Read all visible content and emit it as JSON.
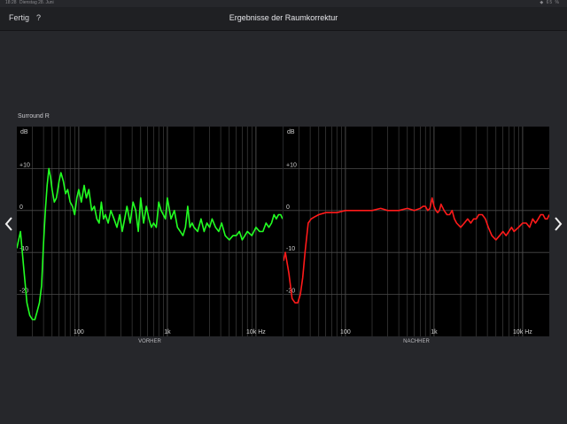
{
  "status_bar": {
    "time": "18:28",
    "date": "Dienstag 28. Juni",
    "right": "◆ 65 %"
  },
  "nav": {
    "done_label": "Fertig",
    "help_label": "?",
    "title": "Ergebnisse der Raumkorrektur"
  },
  "channel_label": "Surround R",
  "colors": {
    "before": "#22ff22",
    "after": "#ff1a1a",
    "grid": "#4a4a4a",
    "background": "#000000"
  },
  "icons": {
    "left": "chevron-left-icon",
    "right": "chevron-right-icon"
  },
  "chart_data": [
    {
      "type": "line",
      "caption": "VORHER",
      "ylabel": "dB",
      "x_scale": "log",
      "xlim": [
        20,
        20000
      ],
      "ylim": [
        -30,
        20
      ],
      "y_ticks": [
        "+10",
        "0",
        "-10",
        "-20"
      ],
      "x_ticks": [
        "100",
        "1k",
        "10k Hz"
      ],
      "grid": true,
      "series": [
        {
          "x": [
            20,
            22,
            24,
            26,
            28,
            30,
            32,
            34,
            36,
            38,
            40,
            42,
            44,
            46,
            48,
            50,
            53,
            56,
            60,
            63,
            67,
            71,
            75,
            80,
            85,
            90,
            95,
            100,
            107,
            115,
            122,
            130,
            140,
            150,
            160,
            170,
            180,
            190,
            200,
            215,
            230,
            250,
            270,
            290,
            310,
            330,
            350,
            380,
            410,
            440,
            470,
            500,
            540,
            580,
            620,
            660,
            700,
            750,
            800,
            850,
            900,
            950,
            1000,
            1100,
            1200,
            1300,
            1400,
            1500,
            1600,
            1700,
            1800,
            1900,
            2000,
            2200,
            2400,
            2600,
            2800,
            3000,
            3200,
            3500,
            3800,
            4100,
            4500,
            5000,
            5500,
            6000,
            6500,
            7000,
            7500,
            8000,
            9000,
            10000,
            11000,
            12000,
            13000,
            14000,
            15000,
            16000,
            17000,
            18000,
            19000,
            20000
          ],
          "y": [
            -9,
            -5,
            -14,
            -22,
            -25,
            -26,
            -26,
            -24,
            -22,
            -18,
            -8,
            0,
            6,
            10,
            8,
            5,
            2,
            3,
            7,
            9,
            7,
            4,
            5,
            2,
            1,
            -1,
            3,
            5,
            2,
            6,
            3,
            5,
            0,
            1,
            -2,
            -3,
            2,
            -2,
            -1,
            -3,
            0,
            -2,
            -4,
            -1,
            -5,
            -2,
            1,
            -3,
            2,
            0,
            -5,
            3,
            -3,
            1,
            -2,
            -4,
            -3,
            -4,
            2,
            0,
            -1,
            -2,
            3,
            -2,
            0,
            -4,
            -5,
            -6,
            -4,
            1,
            -4,
            -3,
            -4,
            -5,
            -2,
            -5,
            -3,
            -4,
            -2,
            -4,
            -5,
            -3,
            -6,
            -7,
            -6,
            -6,
            -5,
            -7,
            -6,
            -5,
            -6,
            -4,
            -5,
            -5,
            -3,
            -4,
            -3,
            -1,
            -2,
            -1,
            -1,
            -2
          ]
        }
      ]
    },
    {
      "type": "line",
      "caption": "NACHHER",
      "ylabel": "dB",
      "x_scale": "log",
      "xlim": [
        20,
        20000
      ],
      "ylim": [
        -30,
        20
      ],
      "y_ticks": [
        "+10",
        "0",
        "-10",
        "-20"
      ],
      "x_ticks": [
        "100",
        "1k",
        "10k Hz"
      ],
      "grid": true,
      "series": [
        {
          "x": [
            20,
            21,
            23,
            25,
            27,
            29,
            31,
            33,
            35,
            38,
            41,
            45,
            50,
            60,
            80,
            100,
            130,
            160,
            200,
            250,
            300,
            400,
            500,
            600,
            700,
            750,
            800,
            850,
            900,
            950,
            1000,
            1050,
            1100,
            1150,
            1200,
            1300,
            1400,
            1500,
            1600,
            1700,
            1800,
            2000,
            2200,
            2400,
            2600,
            2800,
            3000,
            3200,
            3500,
            3800,
            4100,
            4500,
            5000,
            5500,
            6000,
            6500,
            7000,
            7500,
            8000,
            9000,
            10000,
            11000,
            12000,
            13000,
            14000,
            15000,
            16000,
            17000,
            18000,
            19000,
            20000
          ],
          "y": [
            -12,
            -10,
            -15,
            -21,
            -22,
            -22,
            -20,
            -16,
            -10,
            -3,
            -2,
            -1.5,
            -1,
            -0.5,
            -0.5,
            0,
            0,
            0,
            0,
            0.5,
            0,
            0,
            0.5,
            0,
            0.5,
            1,
            1,
            0,
            0.5,
            3,
            1,
            0,
            -0.5,
            0,
            1.5,
            0,
            -1,
            -1,
            0,
            -2,
            -3,
            -4,
            -3,
            -2,
            -3,
            -2,
            -2,
            -1,
            -1,
            -2,
            -4,
            -6,
            -7,
            -6,
            -5,
            -6,
            -5,
            -4,
            -5,
            -4,
            -3,
            -3,
            -4,
            -2,
            -3,
            -2,
            -1,
            -1,
            -2,
            -2,
            -1
          ]
        }
      ]
    }
  ]
}
